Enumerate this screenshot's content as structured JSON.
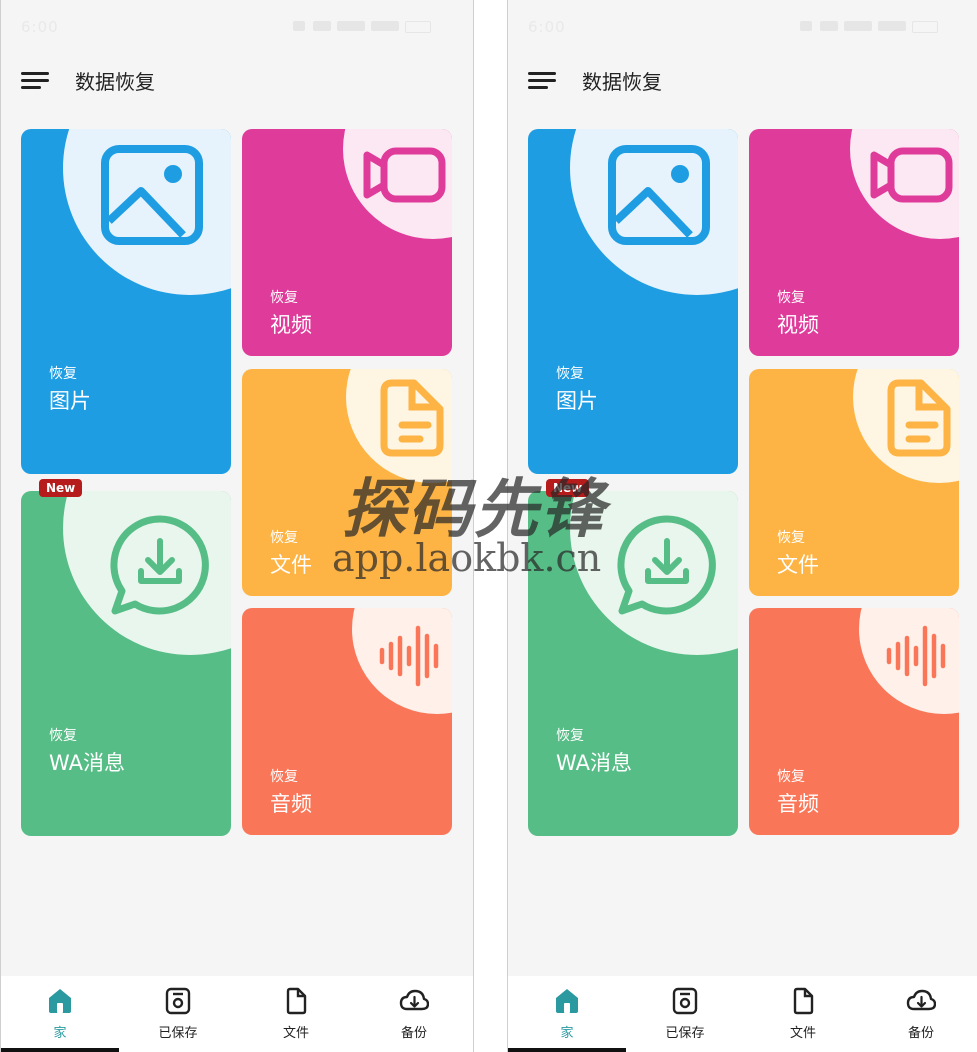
{
  "status_bar": {
    "time": "6:00"
  },
  "app": {
    "title": "数据恢复"
  },
  "cards": {
    "photos": {
      "small": "恢复",
      "big": "图片",
      "color": "#1e9de3"
    },
    "video": {
      "small": "恢复",
      "big": "视频",
      "color": "#df3b9a"
    },
    "files": {
      "small": "恢复",
      "big": "文件",
      "color": "#fdb444"
    },
    "wa": {
      "small": "恢复",
      "big": "WA消息",
      "badge": "New",
      "color": "#57bd86"
    },
    "audio": {
      "small": "恢复",
      "big": "音频",
      "color": "#f97758"
    }
  },
  "nav": {
    "items": [
      {
        "label": "家",
        "icon": "home-icon",
        "active": true
      },
      {
        "label": "已保存",
        "icon": "saved-icon"
      },
      {
        "label": "文件",
        "icon": "file-icon"
      },
      {
        "label": "备份",
        "icon": "cloud-backup-icon"
      }
    ]
  },
  "watermark": {
    "text": "探码先锋",
    "url": "app.laokbk.cn"
  },
  "colors": {
    "accent": "#2a9aa0",
    "background": "#f5f5f5"
  }
}
